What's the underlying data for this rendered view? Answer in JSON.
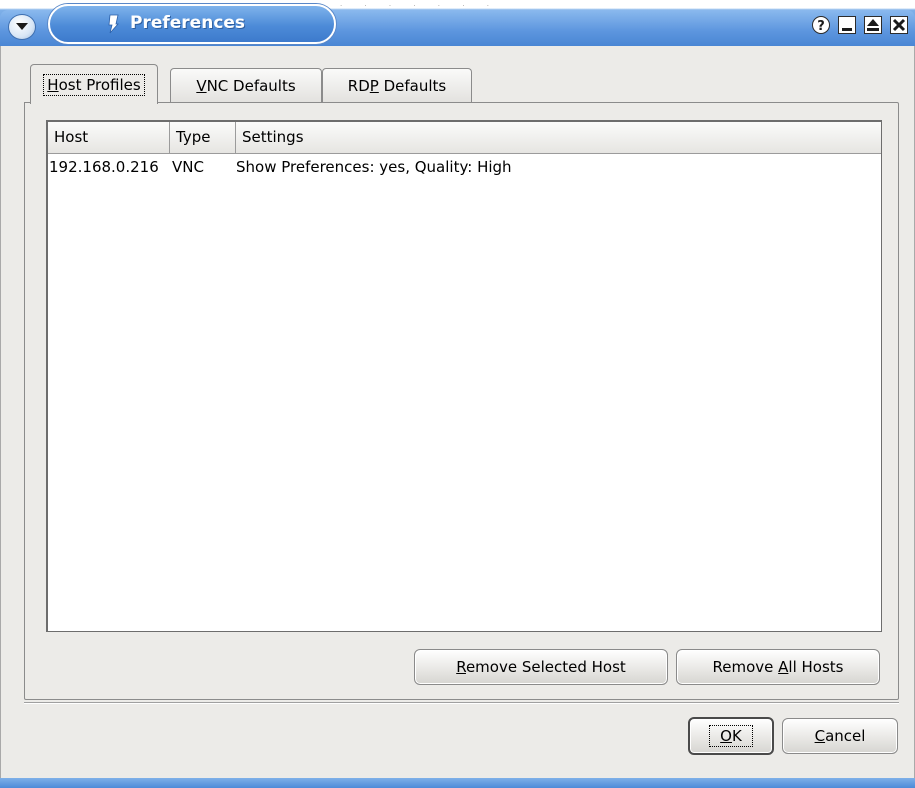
{
  "window": {
    "title": "Preferences",
    "buttons": {
      "help": "?",
      "minimize": "_",
      "maximize": "▲",
      "close": "✕"
    }
  },
  "tabs": [
    {
      "label_u": "H",
      "label_rest": "ost Profiles",
      "active": true
    },
    {
      "label_u": "V",
      "label_rest": "NC Defaults",
      "active": false
    },
    {
      "label_pre": "RD",
      "label_u": "P",
      "label_rest": " Defaults",
      "active": false
    }
  ],
  "host_list": {
    "columns": [
      "Host",
      "Type",
      "Settings"
    ],
    "rows": [
      {
        "host": "192.168.0.216",
        "type": "VNC",
        "settings": "Show Preferences: yes, Quality: High"
      }
    ]
  },
  "buttons": {
    "remove_selected": {
      "u": "R",
      "rest": "emove Selected Host"
    },
    "remove_all": {
      "pre": "Remove ",
      "u": "A",
      "rest": "ll Hosts"
    },
    "ok": {
      "u": "O",
      "rest": "K"
    },
    "cancel": {
      "u": "C",
      "rest": "ancel"
    }
  },
  "colors": {
    "titlebar": "#5c95de",
    "dialog_bg": "#ecebe8"
  }
}
